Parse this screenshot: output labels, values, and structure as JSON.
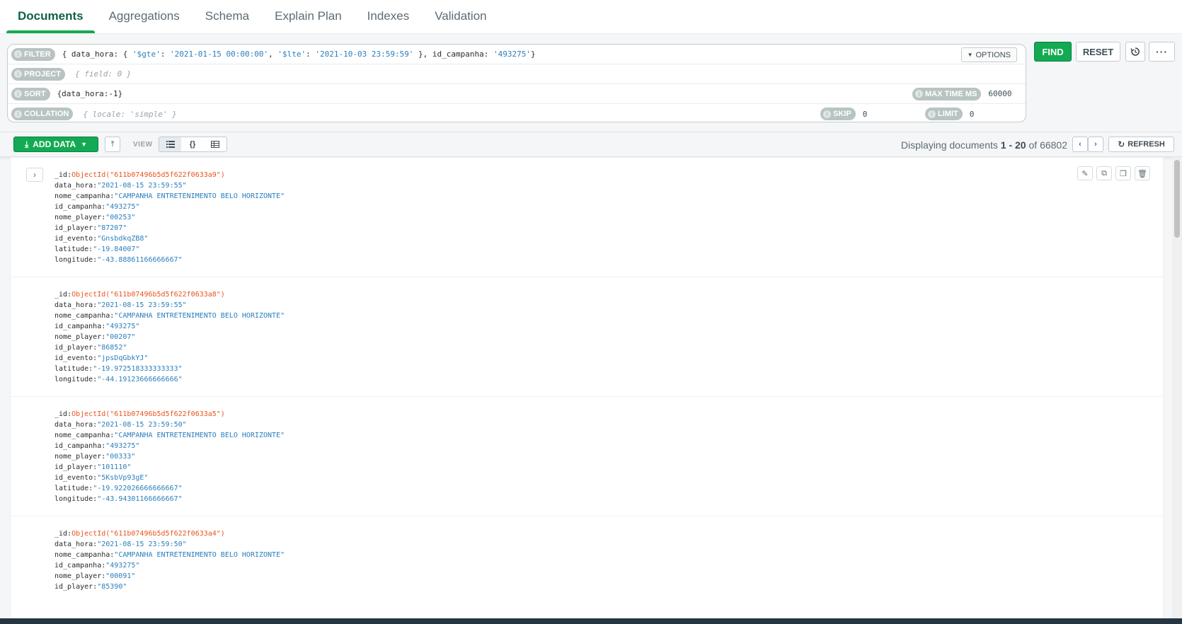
{
  "tabs": [
    "Documents",
    "Aggregations",
    "Schema",
    "Explain Plan",
    "Indexes",
    "Validation"
  ],
  "query": {
    "filter_label": "FILTER",
    "project_label": "PROJECT",
    "project_placeholder": "{ field: 0 }",
    "sort_label": "SORT",
    "sort_value": "{data_hora:-1}",
    "collation_label": "COLLATION",
    "collation_placeholder": "{ locale: 'simple' }",
    "options_label": "OPTIONS",
    "max_time_label": "MAX TIME MS",
    "max_time_value": "60000",
    "skip_label": "SKIP",
    "skip_value": "0",
    "limit_label": "LIMIT",
    "limit_value": "0",
    "filter_parts": {
      "p1": "{ data_hora: { ",
      "k1": "'$gte'",
      "p2": ": ",
      "v1": "'2021-01-15 00:00:00'",
      "p3": ", ",
      "k2": "'$lte'",
      "p4": ": ",
      "v2": "'2021-10-03 23:59:59'",
      "p5": " }, id_campanha: ",
      "v3": "'493275'",
      "p6": "}"
    }
  },
  "buttons": {
    "find": "FIND",
    "reset": "RESET",
    "add_data": "ADD DATA",
    "view_label": "VIEW",
    "refresh": "REFRESH"
  },
  "pagination": {
    "prefix": "Displaying documents ",
    "range": "1 - 20",
    "of": " of ",
    "total": "66802"
  },
  "documents": [
    {
      "_id": "ObjectId(\"611b07496b5d5f622f0633a9\")",
      "data_hora": "\"2021-08-15 23:59:55\"",
      "nome_campanha": "\"CAMPANHA ENTRETENIMENTO BELO HORIZONTE\"",
      "id_campanha": "\"493275\"",
      "nome_player": "\"00253\"",
      "id_player": "\"87207\"",
      "id_evento": "\"GnsbdkqZB8\"",
      "latitude": "\"-19.84007\"",
      "longitude": "\"-43.88861166666667\""
    },
    {
      "_id": "ObjectId(\"611b07496b5d5f622f0633a8\")",
      "data_hora": "\"2021-08-15 23:59:55\"",
      "nome_campanha": "\"CAMPANHA ENTRETENIMENTO BELO HORIZONTE\"",
      "id_campanha": "\"493275\"",
      "nome_player": "\"00207\"",
      "id_player": "\"86852\"",
      "id_evento": "\"jpsDqGbkYJ\"",
      "latitude": "\"-19.972518333333333\"",
      "longitude": "\"-44.19123666666666\""
    },
    {
      "_id": "ObjectId(\"611b07496b5d5f622f0633a5\")",
      "data_hora": "\"2021-08-15 23:59:50\"",
      "nome_campanha": "\"CAMPANHA ENTRETENIMENTO BELO HORIZONTE\"",
      "id_campanha": "\"493275\"",
      "nome_player": "\"00333\"",
      "id_player": "\"101110\"",
      "id_evento": "\"5KsbVp93gE\"",
      "latitude": "\"-19.922026666666667\"",
      "longitude": "\"-43.94301166666667\""
    },
    {
      "_id": "ObjectId(\"611b07496b5d5f622f0633a4\")",
      "data_hora": "\"2021-08-15 23:59:50\"",
      "nome_campanha": "\"CAMPANHA ENTRETENIMENTO BELO HORIZONTE\"",
      "id_campanha": "\"493275\"",
      "nome_player": "\"00091\"",
      "id_player": "\"85390\""
    }
  ],
  "colors": {
    "accent": "#13aa52",
    "tab_active": "#116149",
    "string_value": "#2a7fbd",
    "objectid_value": "#e9541d"
  },
  "icons": {
    "add_data": "download-icon",
    "import": "upload-icon",
    "history": "history-icon",
    "more": "ellipsis-icon",
    "view_list": "list-view-icon",
    "view_json": "json-view-icon",
    "view_table": "table-view-icon",
    "prev": "chevron-left-icon",
    "next": "chevron-right-icon",
    "refresh": "refresh-icon",
    "expand": "chevron-right-icon",
    "edit": "pencil-icon",
    "copy": "copy-icon",
    "clone": "clone-icon",
    "delete": "trash-icon"
  }
}
